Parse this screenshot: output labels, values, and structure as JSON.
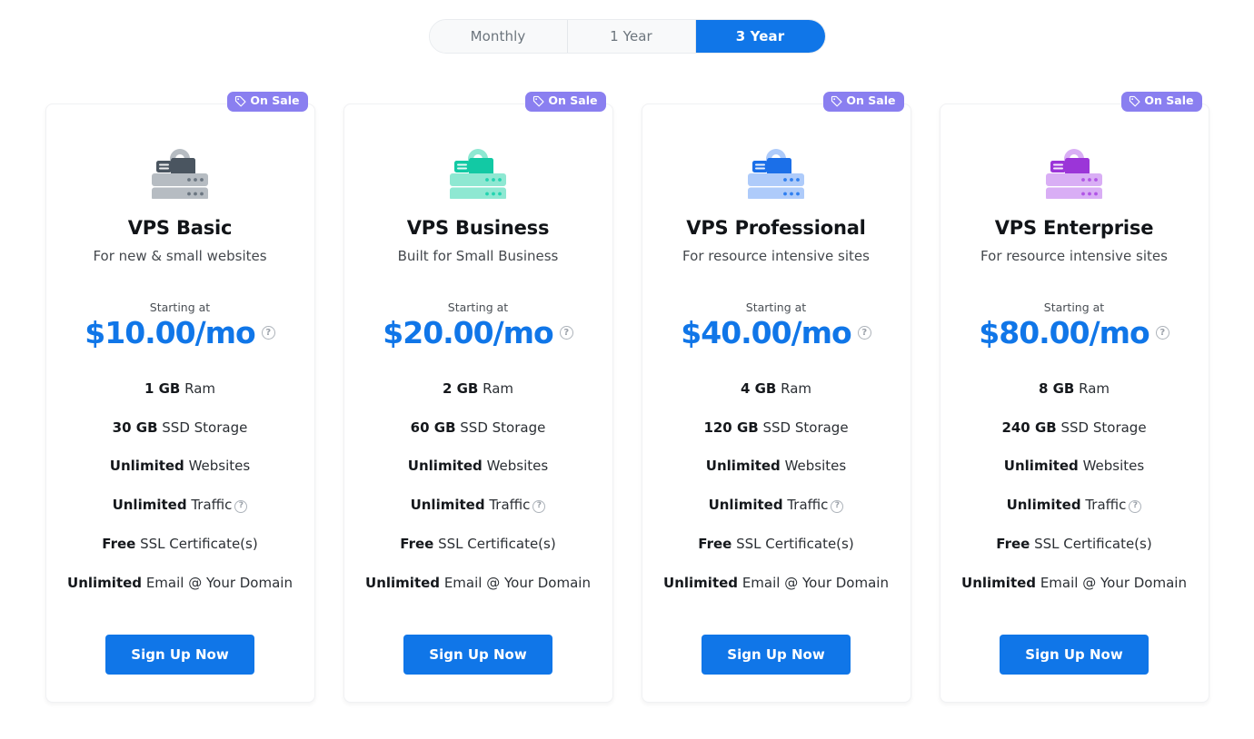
{
  "billing_toggle": {
    "name": "billing-period",
    "options": [
      {
        "label": "Monthly",
        "active": false
      },
      {
        "label": "1 Year",
        "active": false
      },
      {
        "label": "3 Year",
        "active": true
      }
    ],
    "active_label": "3 Year",
    "active_color": "#1076e8"
  },
  "badge": {
    "label": "On Sale",
    "color": "#8a7ff0",
    "icon": "tag-icon"
  },
  "labels": {
    "starting_at": "Starting at",
    "cta": "Sign Up Now",
    "help_glyph": "?"
  },
  "colors": {
    "price": "#1076e8",
    "cta": "#1076e8",
    "badge": "#8a7ff0"
  },
  "plans": [
    {
      "name": "VPS Basic",
      "description": "For new & small websites",
      "starting_at": "Starting at",
      "price": "$10.00/mo",
      "price_has_tooltip": true,
      "icon": {
        "name": "server-lock-icon",
        "body": "#b6bcc2",
        "lock": "#4a5560",
        "dots": "#6b7681"
      },
      "features": [
        {
          "value": "1 GB",
          "text": "Ram",
          "tooltip": false
        },
        {
          "value": "30 GB",
          "text": "SSD Storage",
          "tooltip": false
        },
        {
          "value": "Unlimited",
          "text": "Websites",
          "tooltip": false
        },
        {
          "value": "Unlimited",
          "text": "Traffic",
          "tooltip": true
        },
        {
          "value": "Free",
          "text": "SSL Certificate(s)",
          "tooltip": false
        },
        {
          "value": "Unlimited",
          "text": "Email @ Your Domain",
          "tooltip": false
        }
      ],
      "cta": "Sign Up Now",
      "badge": "On Sale"
    },
    {
      "name": "VPS Business",
      "description": "Built for Small Business",
      "starting_at": "Starting at",
      "price": "$20.00/mo",
      "price_has_tooltip": true,
      "icon": {
        "name": "server-lock-icon",
        "body": "#8ee8d2",
        "lock": "#12c9a4",
        "dots": "#23d4b0"
      },
      "features": [
        {
          "value": "2 GB",
          "text": "Ram",
          "tooltip": false
        },
        {
          "value": "60 GB",
          "text": "SSD Storage",
          "tooltip": false
        },
        {
          "value": "Unlimited",
          "text": "Websites",
          "tooltip": false
        },
        {
          "value": "Unlimited",
          "text": "Traffic",
          "tooltip": true
        },
        {
          "value": "Free",
          "text": "SSL Certificate(s)",
          "tooltip": false
        },
        {
          "value": "Unlimited",
          "text": "Email @ Your Domain",
          "tooltip": false
        }
      ],
      "cta": "Sign Up Now",
      "badge": "On Sale"
    },
    {
      "name": "VPS Professional",
      "description": "For resource intensive sites",
      "starting_at": "Starting at",
      "price": "$40.00/mo",
      "price_has_tooltip": true,
      "icon": {
        "name": "server-lock-icon",
        "body": "#aecbfa",
        "lock": "#1b6fe8",
        "dots": "#2f7ff0"
      },
      "features": [
        {
          "value": "4 GB",
          "text": "Ram",
          "tooltip": false
        },
        {
          "value": "120 GB",
          "text": "SSD Storage",
          "tooltip": false
        },
        {
          "value": "Unlimited",
          "text": "Websites",
          "tooltip": false
        },
        {
          "value": "Unlimited",
          "text": "Traffic",
          "tooltip": true
        },
        {
          "value": "Free",
          "text": "SSL Certificate(s)",
          "tooltip": false
        },
        {
          "value": "Unlimited",
          "text": "Email @ Your Domain",
          "tooltip": false
        }
      ],
      "cta": "Sign Up Now",
      "badge": "On Sale"
    },
    {
      "name": "VPS Enterprise",
      "description": "For resource intensive sites",
      "starting_at": "Starting at",
      "price": "$80.00/mo",
      "price_has_tooltip": true,
      "icon": {
        "name": "server-lock-icon",
        "body": "#d9aef5",
        "lock": "#9b35d8",
        "dots": "#b155e6"
      },
      "features": [
        {
          "value": "8 GB",
          "text": "Ram",
          "tooltip": false
        },
        {
          "value": "240 GB",
          "text": "SSD Storage",
          "tooltip": false
        },
        {
          "value": "Unlimited",
          "text": "Websites",
          "tooltip": false
        },
        {
          "value": "Unlimited",
          "text": "Traffic",
          "tooltip": true
        },
        {
          "value": "Free",
          "text": "SSL Certificate(s)",
          "tooltip": false
        },
        {
          "value": "Unlimited",
          "text": "Email @ Your Domain",
          "tooltip": false
        }
      ],
      "cta": "Sign Up Now",
      "badge": "On Sale"
    }
  ]
}
